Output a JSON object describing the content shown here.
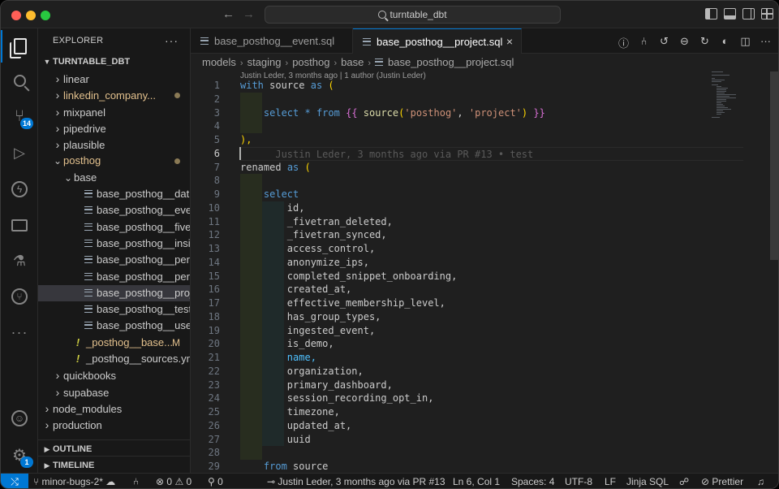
{
  "titlebar": {
    "search_text": "turntable_dbt"
  },
  "activity": {
    "scm_badge": "14",
    "settings_badge": "1"
  },
  "sidebar": {
    "header": "EXPLORER",
    "more": "···",
    "root": "TURNTABLE_DBT",
    "items": [
      {
        "label": "linear",
        "type": "folder",
        "open": false,
        "indent": 1
      },
      {
        "label": "linkedin_company...",
        "type": "folder",
        "open": false,
        "indent": 1,
        "modified": true
      },
      {
        "label": "mixpanel",
        "type": "folder",
        "open": false,
        "indent": 1
      },
      {
        "label": "pipedrive",
        "type": "folder",
        "open": false,
        "indent": 1
      },
      {
        "label": "plausible",
        "type": "folder",
        "open": false,
        "indent": 1
      },
      {
        "label": "posthog",
        "type": "folder",
        "open": true,
        "indent": 1,
        "modified": true
      },
      {
        "label": "base",
        "type": "folder",
        "open": true,
        "indent": 2
      },
      {
        "label": "base_posthog__dat...",
        "type": "sql",
        "indent": 3
      },
      {
        "label": "base_posthog__eve...",
        "type": "sql",
        "indent": 3
      },
      {
        "label": "base_posthog__five...",
        "type": "sql",
        "indent": 3
      },
      {
        "label": "base_posthog__insi...",
        "type": "sql",
        "indent": 3
      },
      {
        "label": "base_posthog__per...",
        "type": "sql",
        "indent": 3
      },
      {
        "label": "base_posthog__per...",
        "type": "sql",
        "indent": 3
      },
      {
        "label": "base_posthog__proj...",
        "type": "sql",
        "indent": 3,
        "selected": true
      },
      {
        "label": "base_posthog__test...",
        "type": "sql",
        "indent": 3
      },
      {
        "label": "base_posthog__use...",
        "type": "sql",
        "indent": 3
      },
      {
        "label": "_posthog__base...",
        "type": "yaml",
        "indent": 2,
        "modified_letter": "M"
      },
      {
        "label": "_posthog__sources.yml",
        "type": "yaml",
        "indent": 2
      },
      {
        "label": "quickbooks",
        "type": "folder",
        "open": false,
        "indent": 1
      },
      {
        "label": "supabase",
        "type": "folder",
        "open": false,
        "indent": 1
      },
      {
        "label": "node_modules",
        "type": "folder",
        "open": false,
        "indent": 0
      },
      {
        "label": "production",
        "type": "folder",
        "open": false,
        "indent": 0
      }
    ],
    "outline": "OUTLINE",
    "timeline": "TIMELINE"
  },
  "tabs": [
    {
      "label": "base_posthog__event.sql",
      "active": false
    },
    {
      "label": "base_posthog__project.sql",
      "active": true,
      "close": "×"
    }
  ],
  "breadcrumb": [
    "models",
    "staging",
    "posthog",
    "base",
    "base_posthog__project.sql"
  ],
  "editor": {
    "codelens": "Justin Leder, 3 months ago | 1 author (Justin Leder)",
    "blame_line6": "Justin Leder, 3 months ago via PR #13 • test",
    "current_line": 6,
    "line_numbers": [
      "1",
      "2",
      "3",
      "4",
      "5",
      "6",
      "7",
      "8",
      "9",
      "10",
      "11",
      "12",
      "13",
      "14",
      "15",
      "16",
      "17",
      "18",
      "19",
      "20",
      "21",
      "22",
      "23",
      "24",
      "25",
      "26",
      "27",
      "28",
      "29"
    ],
    "columns": [
      "id,",
      "_fivetran_deleted,",
      "_fivetran_synced,",
      "access_control,",
      "anonymize_ips,",
      "completed_snippet_onboarding,",
      "created_at,",
      "effective_membership_level,",
      "has_group_types,",
      "ingested_event,",
      "is_demo,",
      "name,",
      "organization,",
      "primary_dashboard,",
      "session_recording_opt_in,",
      "timezone,",
      "updated_at,",
      "uuid"
    ],
    "tokens": {
      "with": "with",
      "source": "source",
      "as": "as",
      "open_paren": "(",
      "close_paren_comma": "),",
      "select": "select",
      "star_from": "* from",
      "jinja_open": "{{",
      "source_fn": "source",
      "arg1": "'posthog'",
      "comma": ",",
      "arg2": "'project'",
      "fn_close": ")",
      "jinja_close": "}}",
      "renamed": "renamed",
      "from": "from"
    }
  },
  "statusbar": {
    "branch": "minor-bugs-2*",
    "errors": "0",
    "warnings": "0",
    "ports": "0",
    "blame": "Justin Leder, 3 months ago via PR #13",
    "position": "Ln 6, Col 1",
    "spaces": "Spaces: 4",
    "encoding": "UTF-8",
    "eol": "LF",
    "language": "Jinja SQL",
    "prettier": "Prettier"
  },
  "colors": {
    "accent": "#0078d4",
    "keyword": "#569cd6",
    "string": "#ce9178",
    "function": "#dcdcaa",
    "modified": "#e2c08d"
  }
}
